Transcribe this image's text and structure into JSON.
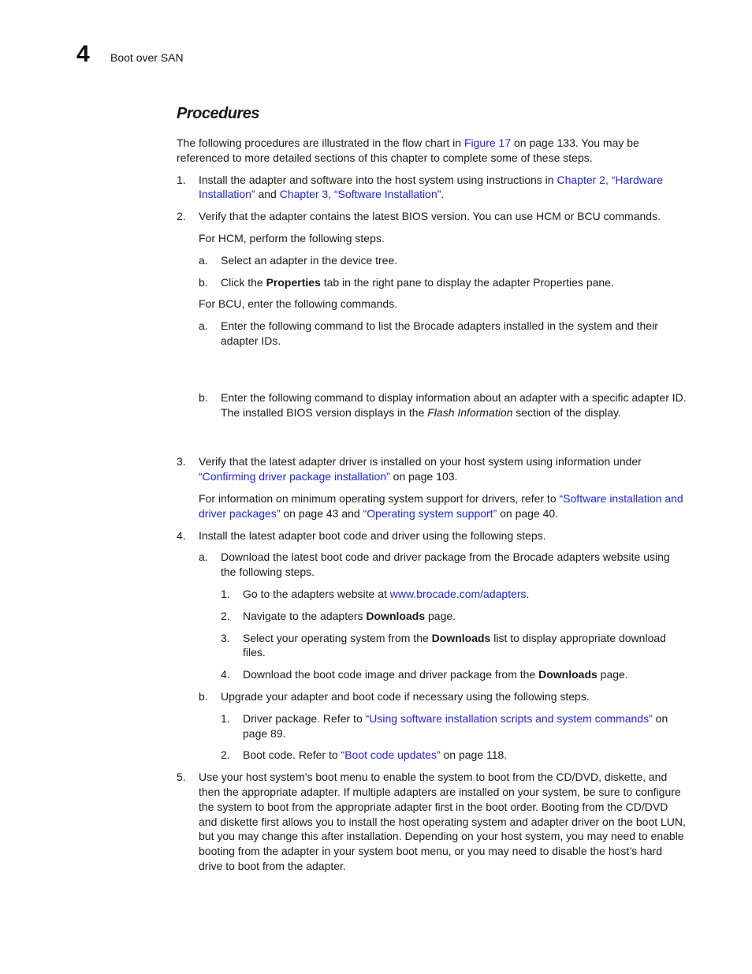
{
  "header": {
    "chapter_number": "4",
    "chapter_title": "Boot over SAN"
  },
  "section": {
    "title": "Procedures"
  },
  "intro": {
    "t1": "The following procedures are illustrated in the flow chart in ",
    "link1": "Figure 17",
    "t2": " on page 133. You may be referenced to more detailed sections of this chapter to complete some of these steps."
  },
  "steps": {
    "s1": {
      "num": "1.",
      "t1": "Install the adapter and software into the host system using instructions in ",
      "link1": "Chapter 2, “Hardware Installation”",
      "t2": " and ",
      "link2": "Chapter 3, “Software Installation”",
      "t3": "."
    },
    "s2": {
      "num": "2.",
      "text": "Verify that the adapter contains the latest BIOS version. You can use HCM or BCU commands.",
      "hcm_intro": "For HCM, perform the following steps.",
      "hcm_a": {
        "num": "a.",
        "text": "Select an adapter in the device tree."
      },
      "hcm_b": {
        "num": "b.",
        "t1": "Click the ",
        "bold": "Properties",
        "t2": " tab in the right pane to display the adapter Properties pane."
      },
      "bcu_intro": "For BCU, enter the following commands.",
      "bcu_a": {
        "num": "a.",
        "text": "Enter the following command to list the Brocade adapters installed in the system and their adapter IDs."
      },
      "bcu_b": {
        "num": "b.",
        "t1": "Enter the following command to display information about an adapter with a specific adapter ID. The installed BIOS version displays in the ",
        "italic": "Flash Information",
        "t2": " section of the display."
      }
    },
    "s3": {
      "num": "3.",
      "t1": "Verify that the latest adapter driver is installed on your host system using information under ",
      "link1": "“Confirming driver package installation”",
      "t2": " on page 103.",
      "p_t1": "For information on minimum operating system support for drivers, refer to ",
      "p_link1": "“Software installation and driver packages”",
      "p_t2": " on page 43 and ",
      "p_link2": "“Operating system support”",
      "p_t3": " on page 40."
    },
    "s4": {
      "num": "4.",
      "text": "Install the latest adapter boot code and driver using the following steps.",
      "a": {
        "num": "a.",
        "text": "Download the latest boot code and driver package from the Brocade adapters website using the following steps.",
        "i1": {
          "num": "1.",
          "t1": "Go to the adapters website at ",
          "link": "www.brocade.com/adapters",
          "t2": "."
        },
        "i2": {
          "num": "2.",
          "t1": "Navigate to the adapters ",
          "bold": "Downloads",
          "t2": " page."
        },
        "i3": {
          "num": "3.",
          "t1": "Select your operating system from the ",
          "bold": "Downloads",
          "t2": " list to display appropriate download files."
        },
        "i4": {
          "num": "4.",
          "t1": "Download the boot code image and driver package from the ",
          "bold": "Downloads",
          "t2": " page."
        }
      },
      "b": {
        "num": "b.",
        "text": "Upgrade your adapter and boot code if necessary using the following steps.",
        "i1": {
          "num": "1.",
          "t1": "Driver package. Refer to ",
          "link": "“Using software installation scripts and system commands”",
          "t2": " on page 89."
        },
        "i2": {
          "num": "2.",
          "t1": "Boot code. Refer to ",
          "link": "“Boot code updates”",
          "t2": " on page 118."
        }
      }
    },
    "s5": {
      "num": "5.",
      "text": "Use your host system’s boot menu to enable the system to boot from the CD/DVD, diskette, and then the appropriate adapter. If multiple adapters are installed on your system, be sure to configure the system to boot from the appropriate adapter first in the boot order. Booting from the CD/DVD and diskette first allows you to install the host operating system and adapter driver on the boot LUN, but you may change this after installation. Depending on your host system, you may need to enable booting from the adapter in your system boot menu, or you may need to disable the host’s hard drive to boot from the adapter."
    }
  },
  "colors": {
    "link": "#2222ee",
    "text": "#1a1a1a"
  }
}
